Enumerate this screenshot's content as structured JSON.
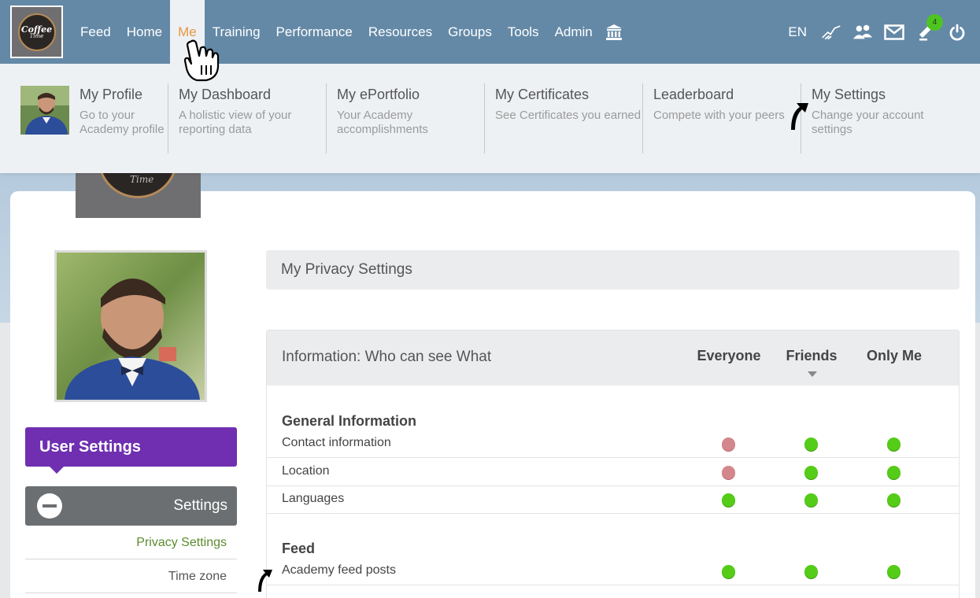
{
  "logo": {
    "line1": "Coffee",
    "line2": "Time"
  },
  "nav": {
    "items": [
      {
        "label": "Feed",
        "active": false
      },
      {
        "label": "Home",
        "active": false
      },
      {
        "label": "Me",
        "active": true
      },
      {
        "label": "Training",
        "active": false
      },
      {
        "label": "Performance",
        "active": false
      },
      {
        "label": "Resources",
        "active": false
      },
      {
        "label": "Groups",
        "active": false
      },
      {
        "label": "Tools",
        "active": false
      },
      {
        "label": "Admin",
        "active": false
      }
    ],
    "icons": [
      "bank-icon"
    ],
    "right": {
      "language": "EN",
      "icons": [
        "handshake-icon",
        "friends-icon",
        "mail-icon",
        "notifications-icon",
        "power-icon"
      ],
      "notification_count": "4"
    },
    "active_color": "#e8963f",
    "bar_color": "#6489a7"
  },
  "megamenu": {
    "items": [
      {
        "title": "My Profile",
        "subtitle": "Go to your Academy profile"
      },
      {
        "title": "My Dashboard",
        "subtitle": "A holistic view of your reporting data"
      },
      {
        "title": "My ePortfolio",
        "subtitle": "Your Academy accomplishments"
      },
      {
        "title": "My Certificates",
        "subtitle": "See Certificates you earned"
      },
      {
        "title": "Leaderboard",
        "subtitle": "Compete with your peers"
      },
      {
        "title": "My Settings",
        "subtitle": "Change your account settings"
      }
    ]
  },
  "sidebar": {
    "user_settings": "User Settings",
    "settings": "Settings",
    "links": [
      "Privacy Settings",
      "Time zone"
    ],
    "accent": "#6f2fb0",
    "active_link_color": "#5b8c2e"
  },
  "privacy": {
    "header": "My Privacy Settings",
    "table": {
      "title": "Information: Who can see What",
      "columns": [
        "Everyone",
        "Friends",
        "Only Me"
      ],
      "sections": [
        {
          "title": "General Information",
          "rows": [
            {
              "label": "Contact information",
              "values": [
                "red",
                "green",
                "green"
              ]
            },
            {
              "label": "Location",
              "values": [
                "red",
                "green",
                "green"
              ]
            },
            {
              "label": "Languages",
              "values": [
                "green",
                "green",
                "green"
              ]
            }
          ]
        },
        {
          "title": "Feed",
          "rows": [
            {
              "label": "Academy feed posts",
              "values": [
                "green",
                "green",
                "green"
              ]
            }
          ]
        }
      ]
    },
    "colors": {
      "green": "#55cc17",
      "red": "#d3878c"
    }
  }
}
